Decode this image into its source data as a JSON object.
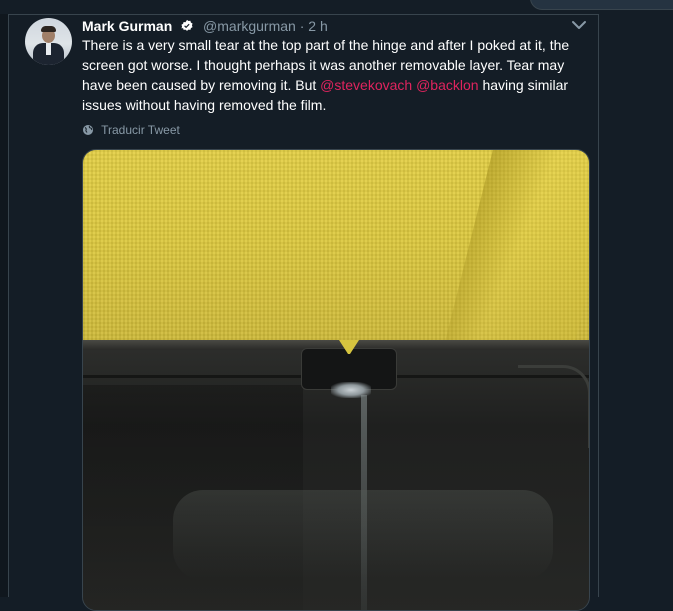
{
  "tweet": {
    "author_name": "Mark Gurman",
    "handle": "@markgurman",
    "separator": "·",
    "time": "2 h",
    "text_part1": "There is a very small tear at the top part of the hinge and after I poked at it, the screen got worse. I thought perhaps it was another removable layer. Tear may have been caused by removing it. But ",
    "mention1": "@stevekovach",
    "text_space": " ",
    "mention2": "@backlon",
    "text_part2": " having similar issues without having removed the film.",
    "translate_label": "Traducir Tweet",
    "verified": true
  },
  "colors": {
    "background": "#141d26",
    "text": "#ffffff",
    "secondary": "#8899a6",
    "mention": "#e0245e",
    "border": "#38444d"
  },
  "icons": {
    "verified": "verified-badge-icon",
    "chevron": "chevron-down-icon",
    "translate": "globe-icon"
  }
}
